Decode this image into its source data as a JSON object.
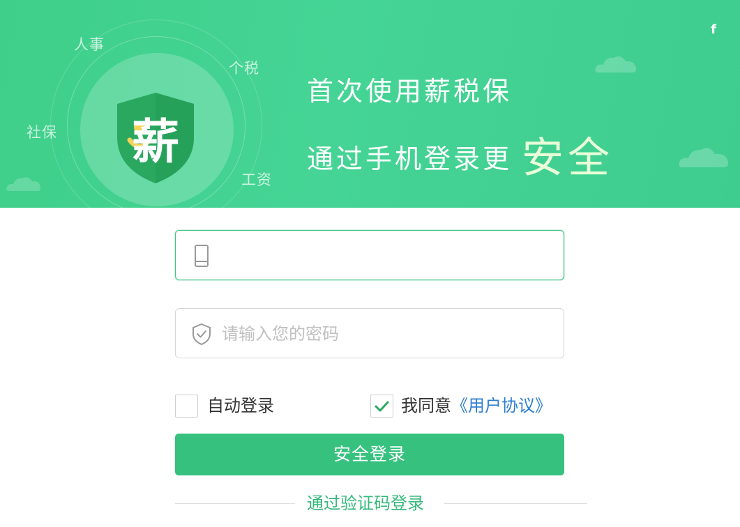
{
  "header": {
    "brand_char": "薪",
    "orbit_labels": {
      "hr": "人事",
      "tax": "个税",
      "social": "社保",
      "salary": "工资"
    },
    "headline_line1": "首次使用薪税保",
    "headline_line2": "通过手机登录更",
    "headline_emphasis": "安全",
    "close_symbol": "f"
  },
  "form": {
    "phone": {
      "value": "",
      "placeholder": "",
      "icon": "phone-icon"
    },
    "password": {
      "value": "",
      "placeholder": "请输入您的密码",
      "icon": "shield-check-icon"
    },
    "auto_login": {
      "label": "自动登录",
      "checked": false
    },
    "agreement": {
      "label": "我同意",
      "link": "《用户协议》",
      "checked": true
    },
    "submit_label": "安全登录",
    "sms_login_label": "通过验证码登录"
  },
  "colors": {
    "banner": "#45d495",
    "accent": "#36c17e",
    "link": "#2e7fd0",
    "shield": "#2aa860",
    "shield_mark": "#f3d25a"
  }
}
